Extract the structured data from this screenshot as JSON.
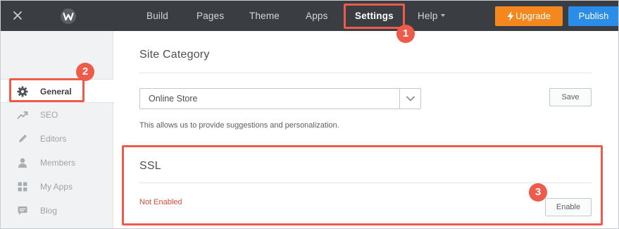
{
  "topbar": {
    "nav": [
      {
        "label": "Build"
      },
      {
        "label": "Pages"
      },
      {
        "label": "Theme"
      },
      {
        "label": "Apps"
      },
      {
        "label": "Settings"
      },
      {
        "label": "Help"
      }
    ],
    "upgrade_label": "Upgrade",
    "publish_label": "Publish",
    "colors": {
      "bar": "#3a3e43",
      "upgrade": "#f4881f",
      "publish": "#2a8de8"
    }
  },
  "sidebar": {
    "items": [
      {
        "label": "General",
        "icon": "gear-icon",
        "active": true
      },
      {
        "label": "SEO",
        "icon": "trend-icon"
      },
      {
        "label": "Editors",
        "icon": "pencil-icon"
      },
      {
        "label": "Members",
        "icon": "person-icon"
      },
      {
        "label": "My Apps",
        "icon": "grid-icon"
      },
      {
        "label": "Blog",
        "icon": "comment-icon"
      }
    ]
  },
  "main": {
    "site_category": {
      "title": "Site Category",
      "selected": "Online Store",
      "save_label": "Save",
      "help": "This allows us to provide suggestions and personalization."
    },
    "ssl": {
      "title": "SSL",
      "status": "Not Enabled",
      "enable_label": "Enable"
    }
  },
  "annotations": {
    "color": "#ee5b4b",
    "badges": [
      "1",
      "2",
      "3"
    ]
  }
}
